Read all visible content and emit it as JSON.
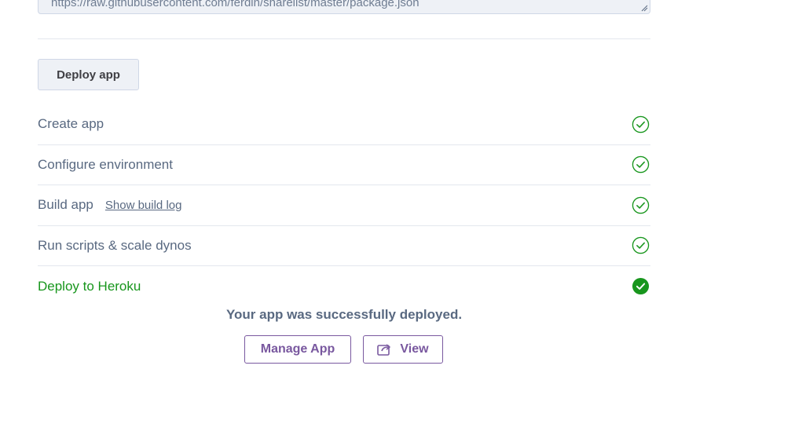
{
  "manifest": {
    "value": "https://raw.githubusercontent.com/ferdin/sharelist/master/package.json"
  },
  "deploy_button": {
    "label": "Deploy app"
  },
  "steps": [
    {
      "label": "Create app",
      "status": "done"
    },
    {
      "label": "Configure environment",
      "status": "done"
    },
    {
      "label": "Build app",
      "status": "done",
      "link": "Show build log"
    },
    {
      "label": "Run scripts & scale dynos",
      "status": "done"
    },
    {
      "label": "Deploy to Heroku",
      "status": "complete"
    }
  ],
  "result": {
    "message": "Your app was successfully deployed.",
    "manage_label": "Manage App",
    "view_label": "View",
    "view_icon": "external-link-icon"
  },
  "colors": {
    "success_green": "#18961d",
    "brand_purple": "#79589f",
    "text_gray": "#596981"
  }
}
